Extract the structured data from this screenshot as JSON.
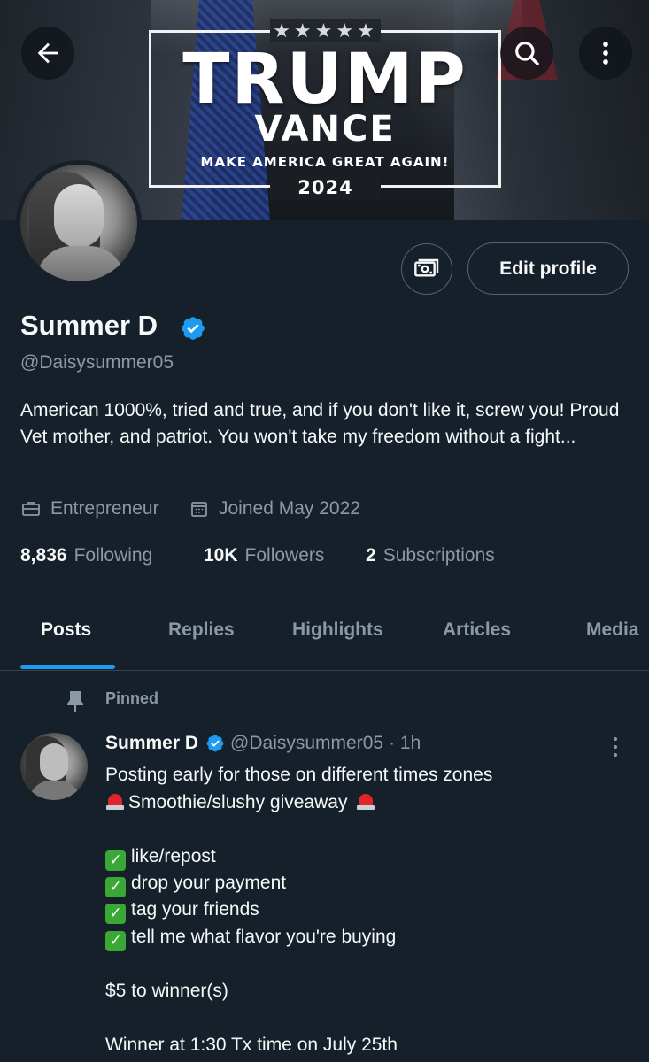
{
  "banner": {
    "stars": "★★★★★",
    "title": "TRUMP",
    "subtitle": "VANCE",
    "slogan": "MAKE AMERICA GREAT AGAIN!",
    "year": "2024"
  },
  "header": {
    "back_icon": "arrow-left-icon",
    "search_icon": "search-icon",
    "more_icon": "more-vertical-icon"
  },
  "actions": {
    "money_icon": "money-icon",
    "edit_profile_label": "Edit profile"
  },
  "profile": {
    "display_name": "Summer D",
    "handle": "@Daisysummer05",
    "bio": "American 1000%, tried and true, and if you don't like it, screw you!  Proud Vet mother, and patriot. You won't take my freedom without a fight...",
    "profession": "Entrepreneur",
    "joined": "Joined May 2022",
    "following_count": "8,836",
    "following_label": "Following",
    "followers_count": "10K",
    "followers_label": "Followers",
    "subscriptions_count": "2",
    "subscriptions_label": "Subscriptions"
  },
  "tabs": [
    {
      "label": "Posts",
      "active": true
    },
    {
      "label": "Replies",
      "active": false
    },
    {
      "label": "Highlights",
      "active": false
    },
    {
      "label": "Articles",
      "active": false
    },
    {
      "label": "Media",
      "active": false
    }
  ],
  "colors": {
    "background": "#15202b",
    "accent": "#1d9bf0",
    "secondary_text": "#8b98a5"
  },
  "pinned_post": {
    "pinned_label": "Pinned",
    "author_name": "Summer D",
    "author_handle": "@Daisysummer05",
    "time": "· 1h",
    "lines": [
      "Posting early for those on different times zones",
      "Smoothie/slushy giveaway",
      "like/repost",
      "drop your payment",
      "tag your friends",
      "tell me what flavor you're buying",
      "$5 to winner(s)",
      "Winner at 1:30 Tx time on July 25th"
    ]
  }
}
